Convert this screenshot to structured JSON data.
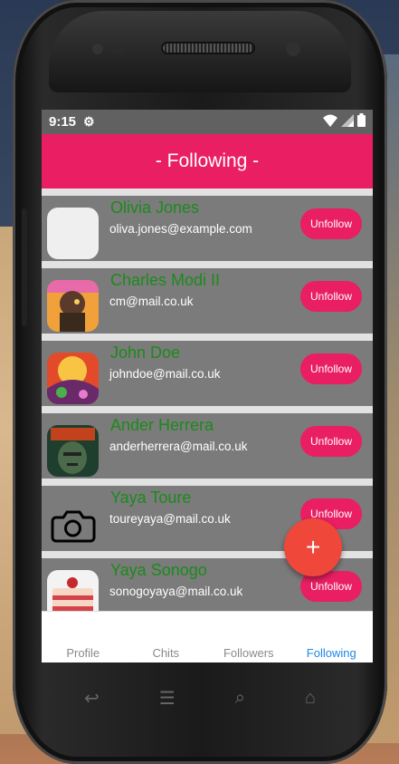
{
  "status": {
    "time": "9:15",
    "settings_icon": "gear-icon",
    "wifi_icon": "wifi-icon",
    "signal_icon": "signal-icon",
    "battery_icon": "battery-icon"
  },
  "header": {
    "title": "- Following -"
  },
  "following": [
    {
      "name": "Olivia Jones",
      "email": "oliva.jones@example.com",
      "button": "Unfollow",
      "avatar": "blank"
    },
    {
      "name": "Charles Modi II",
      "email": "cm@mail.co.uk",
      "button": "Unfollow",
      "avatar": "art-orange"
    },
    {
      "name": "John Doe",
      "email": "johndoe@mail.co.uk",
      "button": "Unfollow",
      "avatar": "art-psychedelic"
    },
    {
      "name": "Ander Herrera",
      "email": "anderherrera@mail.co.uk",
      "button": "Unfollow",
      "avatar": "art-doom"
    },
    {
      "name": "Yaya Toure",
      "email": "toureyaya@mail.co.uk",
      "button": "Unfollow",
      "avatar": "camera-icon"
    },
    {
      "name": "Yaya Sonogo",
      "email": "sonogoyaya@mail.co.uk",
      "button": "Unfollow",
      "avatar": "cake"
    }
  ],
  "fab": {
    "label": "+"
  },
  "tabs": [
    "Profile",
    "Chits",
    "Followers",
    "Following"
  ],
  "active_tab": "Following",
  "colors": {
    "primary": "#e91e63",
    "row_bg": "#7b7b7b",
    "name_text": "#1c8a1c",
    "active_tab": "#1e88e5",
    "fab": "#ef473a"
  }
}
